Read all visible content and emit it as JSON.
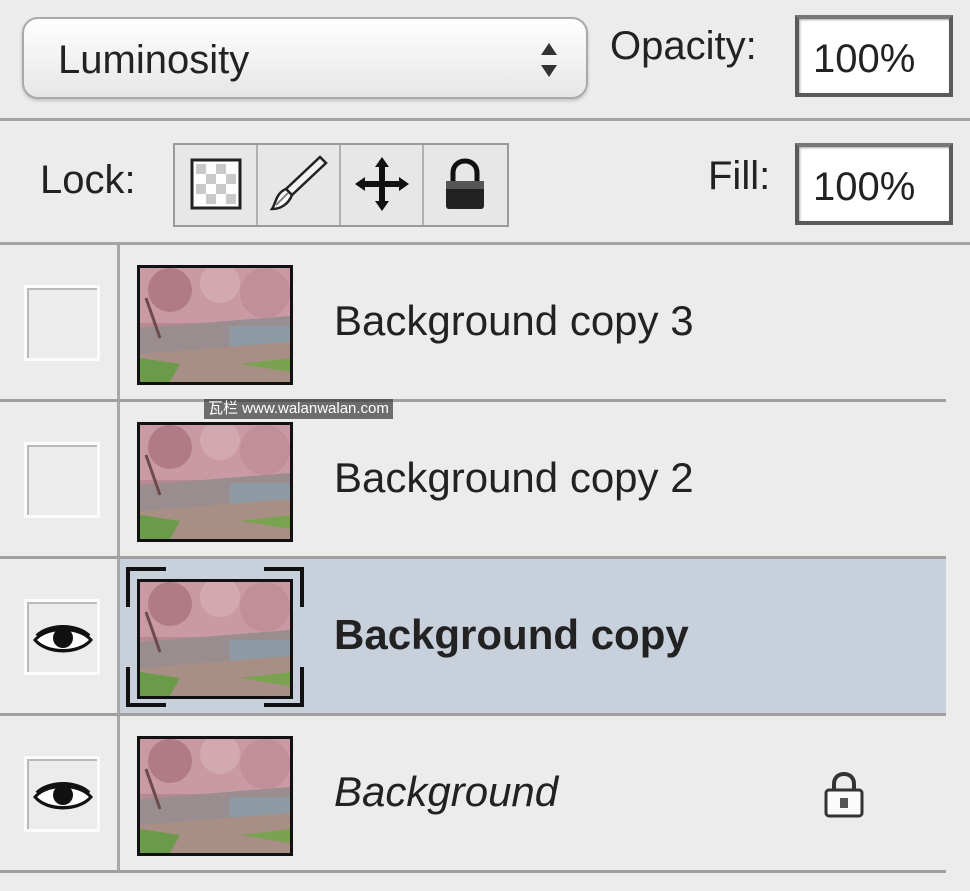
{
  "blend_mode": {
    "value": "Luminosity"
  },
  "opacity": {
    "label": "Opacity:",
    "value": "100%"
  },
  "lock": {
    "label": "Lock:"
  },
  "fill": {
    "label": "Fill:",
    "value": "100%"
  },
  "layers": [
    {
      "name": "Background copy 3",
      "visible": false,
      "selected": false,
      "locked": false
    },
    {
      "name": "Background copy 2",
      "visible": false,
      "selected": false,
      "locked": false
    },
    {
      "name": "Background copy",
      "visible": true,
      "selected": true,
      "locked": false
    },
    {
      "name": "Background",
      "visible": true,
      "selected": false,
      "locked": true
    }
  ],
  "watermark": "瓦栏 www.walanwalan.com",
  "colors": {
    "panel_bg": "#ececec",
    "selected_row": "#c8d0dc",
    "divider": "#a0a0a0"
  },
  "icons": [
    "updown-arrows-icon",
    "lock-transparent-pixels-icon",
    "lock-image-pixels-brush-icon",
    "lock-position-move-icon",
    "lock-all-padlock-icon",
    "eye-icon",
    "padlock-icon"
  ]
}
